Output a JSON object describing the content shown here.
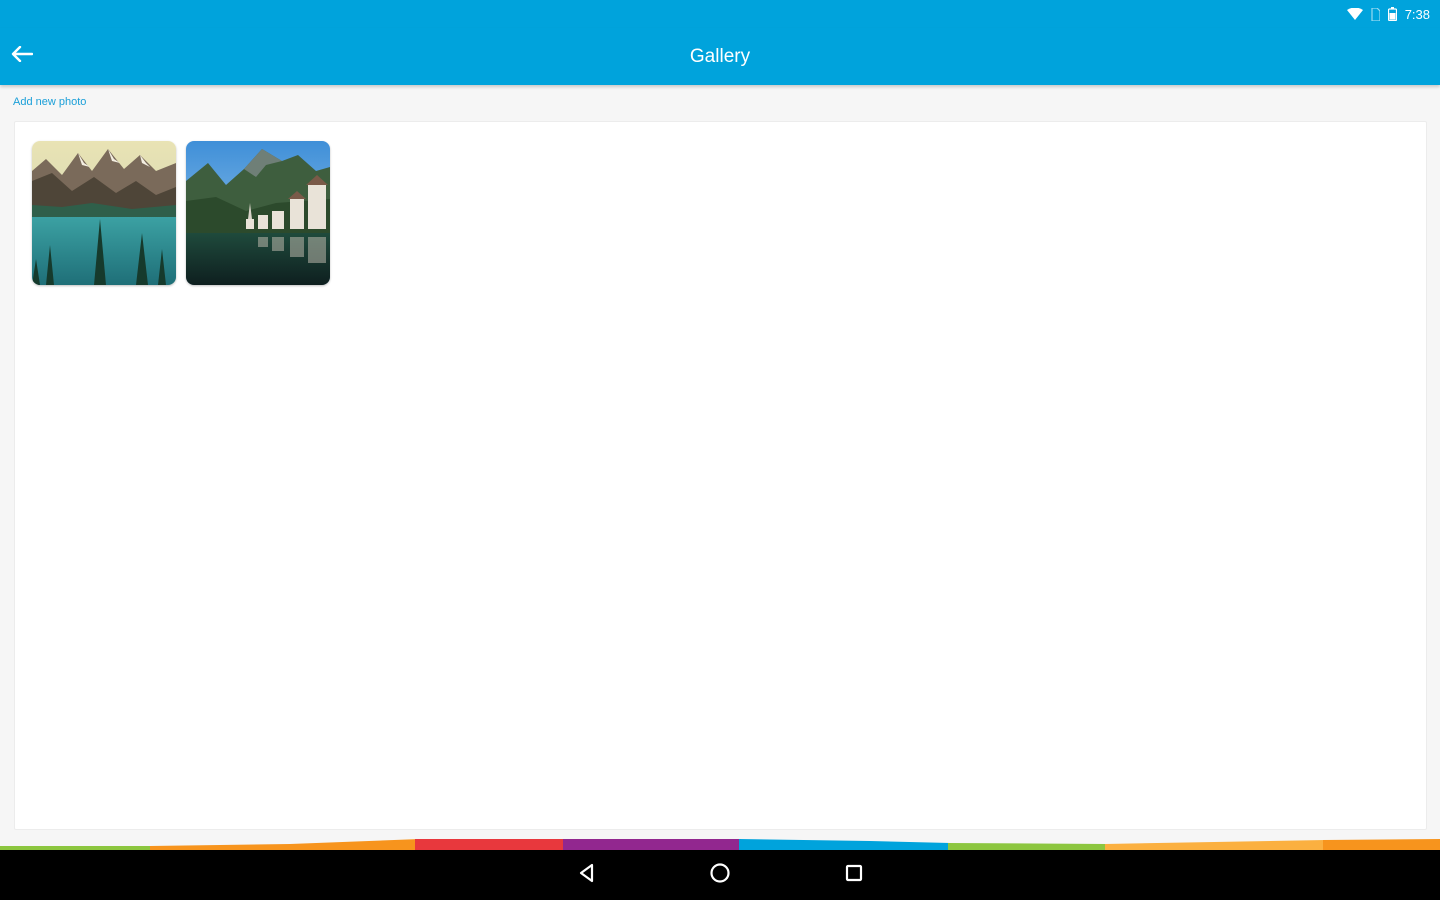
{
  "status_bar": {
    "time": "7:38",
    "icons": [
      "wifi-icon",
      "sim-icon",
      "battery-icon"
    ]
  },
  "app_bar": {
    "title": "Gallery",
    "back_icon": "arrow-back-icon"
  },
  "content": {
    "add_photo_label": "Add new photo",
    "photos": [
      {
        "icon": "mountain-lake-photo"
      },
      {
        "icon": "lakeside-village-photo"
      }
    ]
  },
  "navigation": {
    "buttons": [
      "nav-back-icon",
      "nav-home-icon",
      "nav-recents-icon"
    ]
  },
  "colors": {
    "primary": "#00a3dc",
    "link": "#1a9fd8",
    "rainbow": [
      "#8cc63f",
      "#f7941d",
      "#e8383d",
      "#92278f",
      "#00a3dc",
      "#8cc63f",
      "#fbb040",
      "#f7941d"
    ]
  }
}
